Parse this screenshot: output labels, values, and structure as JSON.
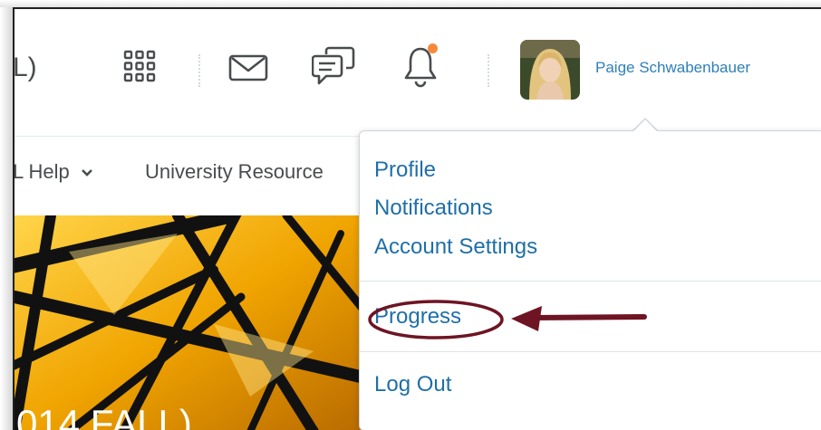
{
  "header": {
    "org_partial": "L)",
    "icons": [
      "waffle-icon",
      "mail-icon",
      "chat-icon",
      "bell-icon"
    ],
    "user_name": "Paige Schwabenbauer",
    "notification_dot_color": "#f58a3c",
    "link_color": "#2e7fb8"
  },
  "nav": {
    "help_label": "L Help",
    "resources_label": "University Resource"
  },
  "hero": {
    "title_partial": "014 FALL)"
  },
  "menu": {
    "items": [
      {
        "label": "Profile"
      },
      {
        "label": "Notifications"
      },
      {
        "label": "Account Settings"
      },
      {
        "label": "Progress"
      },
      {
        "label": "Log Out"
      }
    ]
  },
  "annotation": {
    "color": "#6e1423",
    "target": "Progress"
  }
}
